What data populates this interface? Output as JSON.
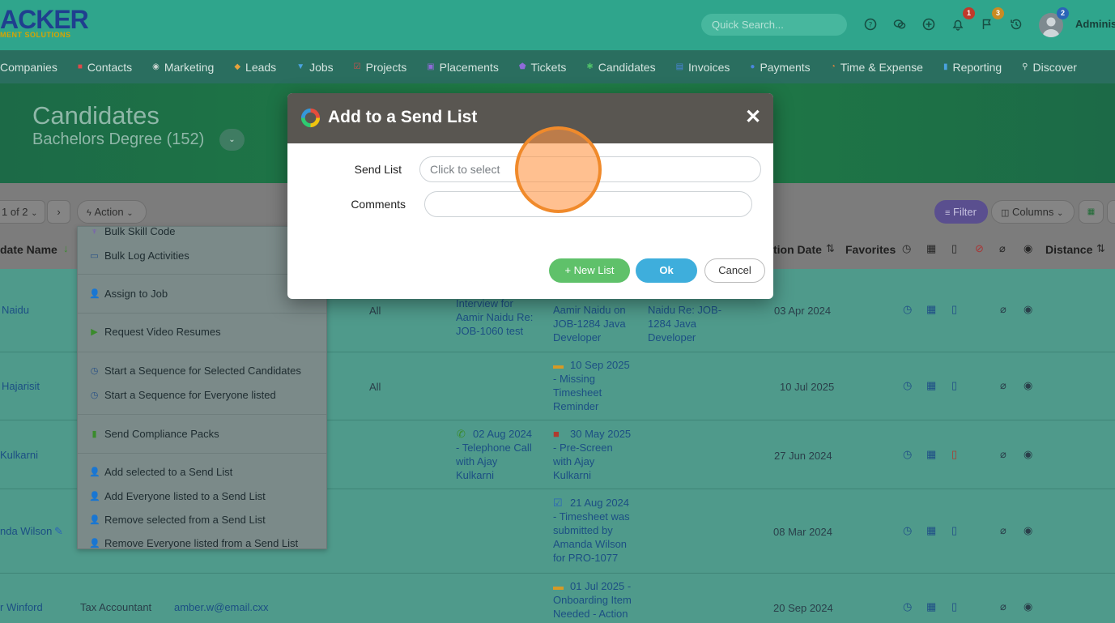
{
  "topbar": {
    "logo_text": "ACKER",
    "logo_sub": "MENT SOLUTIONS",
    "search_placeholder": "Quick Search...",
    "notifications_count": "1",
    "flags_count": "3",
    "avatar_count": "2",
    "user_name": "Adminis"
  },
  "nav": {
    "items": [
      {
        "label": "Companies",
        "icon": "building-icon"
      },
      {
        "label": "Contacts",
        "icon": "contacts-icon"
      },
      {
        "label": "Marketing",
        "icon": "broadcast-icon"
      },
      {
        "label": "Leads",
        "icon": "diamond-icon"
      },
      {
        "label": "Jobs",
        "icon": "trophy-icon"
      },
      {
        "label": "Projects",
        "icon": "checkbox-icon"
      },
      {
        "label": "Placements",
        "icon": "briefcase-icon"
      },
      {
        "label": "Tickets",
        "icon": "shield-icon"
      },
      {
        "label": "Candidates",
        "icon": "people-icon"
      },
      {
        "label": "Invoices",
        "icon": "invoice-icon"
      },
      {
        "label": "Payments",
        "icon": "coin-icon"
      },
      {
        "label": "Time & Expense",
        "icon": "clock-icon"
      },
      {
        "label": "Reporting",
        "icon": "bar-chart-icon"
      },
      {
        "label": "Discover",
        "icon": "search-icon"
      }
    ]
  },
  "header": {
    "title": "Candidates",
    "subtitle": "Bachelors Degree (152)"
  },
  "toolbar": {
    "pager": "1 of 2",
    "pager_next": "›",
    "action_label": "Action",
    "filter_label": "Filter",
    "columns_label": "Columns"
  },
  "table": {
    "headers": {
      "name": "date Name",
      "activation": "tion Date",
      "favorites": "Favorites",
      "distance": "Distance"
    },
    "rows": [
      {
        "name": "Naidu",
        "col_all": "All",
        "activity1": [
          "Interview for",
          "Aamir Naidu Re:",
          "JOB-1060 test"
        ],
        "activity2": [
          "Aamir Naidu on",
          "JOB-1284 Java",
          "Developer"
        ],
        "activity3": [
          "Naidu Re: JOB-",
          "1284 Java",
          "Developer"
        ],
        "date": "03 Apr 2024"
      },
      {
        "name": "Hajarisit",
        "col_all": "All",
        "activity2": [
          "10 Sep 2025",
          "- Missing",
          "Timesheet",
          "Reminder"
        ],
        "date": "10 Jul 2025"
      },
      {
        "name": "Kulkarni",
        "activity1": [
          "02 Aug 2024",
          "- Telephone Call",
          "with   Ajay",
          "Kulkarni"
        ],
        "activity2": [
          "30 May 2025",
          "- Pre-Screen",
          "with   Ajay",
          "Kulkarni"
        ],
        "date": "27 Jun 2024"
      },
      {
        "name": "nda Wilson",
        "activity2": [
          "21 Aug 2024",
          "- Timesheet was",
          "submitted by",
          "Amanda Wilson",
          "for PRO-1077"
        ],
        "date": "08 Mar 2024"
      },
      {
        "name": "r Winford",
        "title": "Tax Accountant",
        "email": "amber.w@email.cxx",
        "activity2": [
          "01 Jul 2025 -",
          "Onboarding Item",
          "Needed - Action"
        ],
        "date": "20 Sep 2024"
      }
    ]
  },
  "action_menu": {
    "items": [
      {
        "label": "Bulk Skill Code",
        "icon": "skill-icon"
      },
      {
        "label": "Bulk Log Activities",
        "icon": "log-icon"
      },
      {
        "label": "Assign to Job",
        "icon": "user-plus-icon"
      },
      {
        "label": "Request Video Resumes",
        "icon": "video-icon"
      },
      {
        "label": "Start a Sequence for Selected Candidates",
        "icon": "alarm-icon"
      },
      {
        "label": "Start a Sequence for Everyone listed",
        "icon": "alarm-icon"
      },
      {
        "label": "Send Compliance Packs",
        "icon": "clipboard-icon"
      },
      {
        "label": "Add selected to a Send List",
        "icon": "user-plus-icon"
      },
      {
        "label": "Add Everyone listed to a Send List",
        "icon": "users-plus-icon"
      },
      {
        "label": "Remove selected from a Send List",
        "icon": "user-minus-icon"
      },
      {
        "label": "Remove Everyone listed from a Send List",
        "icon": "users-minus-icon"
      }
    ]
  },
  "modal": {
    "title": "Add to a Send List",
    "close": "✕",
    "send_list_label": "Send List",
    "send_list_placeholder": "Click to select",
    "comments_label": "Comments",
    "comments_value": "",
    "new_list_label": "New List",
    "ok_label": "Ok",
    "cancel_label": "Cancel"
  },
  "colors": {
    "topbar": "#2fa58c",
    "nav": "#2a6e5f",
    "modal_header": "#595651",
    "new_list": "#5fc16a",
    "ok": "#3eaedc",
    "filter": "#5a4f8f"
  }
}
